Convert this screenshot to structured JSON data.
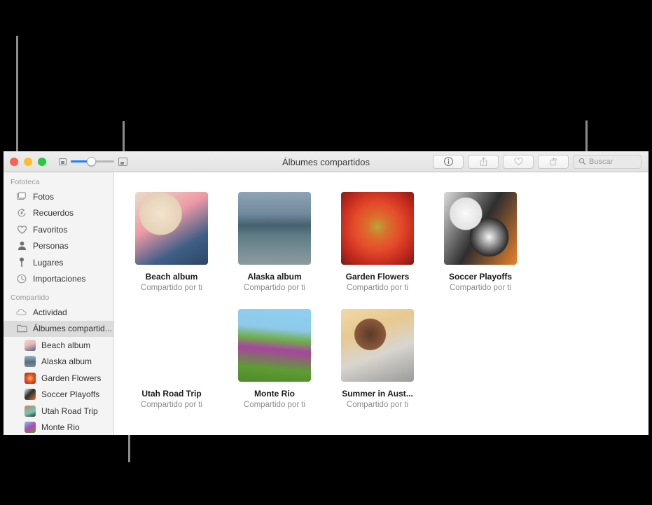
{
  "window": {
    "title": "Álbumes compartidos",
    "traffic_lights": [
      "close",
      "minimize",
      "zoom"
    ],
    "zoom_slider": {
      "small_icon": "small-thumbnail-icon",
      "large_icon": "large-thumbnail-icon",
      "value_percent": 40
    },
    "toolbar_buttons": [
      {
        "name": "info-button",
        "icon": "info-icon"
      },
      {
        "name": "share-button",
        "icon": "share-icon"
      },
      {
        "name": "favorite-button",
        "icon": "heart-icon"
      },
      {
        "name": "rotate-button",
        "icon": "rotate-icon"
      }
    ],
    "search": {
      "placeholder": "Buscar",
      "icon": "search-icon",
      "value": ""
    }
  },
  "sidebar": {
    "sections": [
      {
        "header": "Fototeca",
        "items": [
          {
            "label": "Fotos",
            "icon": "photos-icon"
          },
          {
            "label": "Recuerdos",
            "icon": "memories-icon"
          },
          {
            "label": "Favoritos",
            "icon": "heart-icon"
          },
          {
            "label": "Personas",
            "icon": "person-icon"
          },
          {
            "label": "Lugares",
            "icon": "pin-icon"
          },
          {
            "label": "Importaciones",
            "icon": "clock-icon"
          }
        ]
      },
      {
        "header": "Compartido",
        "items": [
          {
            "label": "Actividad",
            "icon": "cloud-icon"
          },
          {
            "label": "Álbumes compartid...",
            "icon": "folder-icon",
            "selected": true,
            "expanded": true
          }
        ],
        "children": [
          {
            "label": "Beach album",
            "thumb": "#d8c9b8"
          },
          {
            "label": "Alaska album",
            "thumb": "#7d8fa0"
          },
          {
            "label": "Garden Flowers",
            "thumb": "#d7372b"
          },
          {
            "label": "Soccer Playoffs",
            "thumb": "#6b5a4b"
          },
          {
            "label": "Utah Road Trip",
            "thumb": "#c08060"
          },
          {
            "label": "Monte Rio",
            "thumb": "#69a24a"
          }
        ]
      }
    ]
  },
  "content": {
    "shared_by_label": "Compartido por ti",
    "albums": [
      {
        "title": "Beach album",
        "subtitle": "Compartido por ti"
      },
      {
        "title": "Alaska album",
        "subtitle": "Compartido por ti"
      },
      {
        "title": "Garden Flowers",
        "subtitle": "Compartido por ti"
      },
      {
        "title": "Soccer Playoffs",
        "subtitle": "Compartido por ti"
      },
      {
        "title": "Utah Road Trip",
        "subtitle": "Compartido por ti"
      },
      {
        "title": "Monte Rio",
        "subtitle": "Compartido por ti"
      },
      {
        "title": "Summer in Aust...",
        "subtitle": "Compartido por ti"
      }
    ]
  },
  "colors": {
    "accent": "#1a82fb",
    "leader_line": "#8c8c8c",
    "sidebar_bg": "#f4f4f4",
    "selected_bg": "#dcdcdc"
  }
}
